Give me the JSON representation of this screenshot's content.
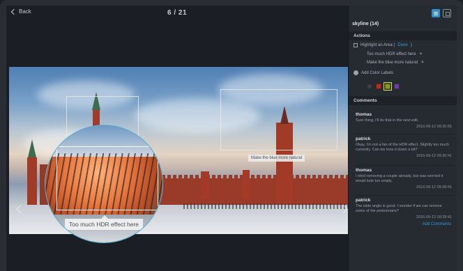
{
  "viewer": {
    "back_label": "Back",
    "counter": "6 / 21",
    "annotations": [
      {
        "label": "Make the blue more natural"
      },
      {
        "label": "Too much HDR effect here"
      }
    ]
  },
  "sidebar": {
    "title": "skyline (14)",
    "actions": {
      "header": "Actions",
      "highlight_label": "Highlight an Area (",
      "done_label": "Done",
      "close_paren": ")",
      "areas": [
        "Too much HDR effect here",
        "Make the blue more natural"
      ],
      "remove_symbol": "×",
      "color_labels_title": "Add Color Labels",
      "swatches": [
        {
          "color": "#3a3f47"
        },
        {
          "color": "#b0302a"
        },
        {
          "color": "#8a9a1e",
          "selected": true
        },
        {
          "color": "#6b3f9c"
        }
      ]
    },
    "comments": {
      "header": "Comments",
      "items": [
        {
          "author": "thomas",
          "text": "Sure thing, I'll do that in the next edit.",
          "time": "2016-09-12 09:30:55"
        },
        {
          "author": "patrick",
          "text": "Okay. I'm not a fan of the HDR effect. Slightly too much currently. Can we tone it down a bit?",
          "time": "2016-09-12 09:30:41"
        },
        {
          "author": "thomas",
          "text": "I tried removing a couple already, but was worried it would look too empty.",
          "time": "2016-09-12 09:28:41"
        },
        {
          "author": "patrick",
          "text": "The wide angle is good. I wonder if we can remove some of the pedestrians?",
          "time": "2016-09-12 09:28:41"
        }
      ],
      "add_label": "Add Comments"
    }
  },
  "colors": {
    "accent": "#2f9ae0",
    "magnifier_ring": "#4fb6e0"
  }
}
